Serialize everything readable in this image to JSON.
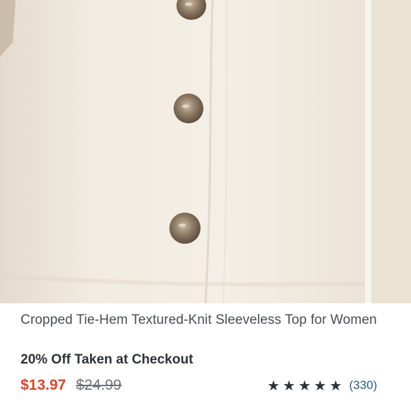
{
  "product": {
    "title": "Cropped Tie-Hem Textured-Knit Sleeveless Top for Women",
    "promo": "20% Off Taken at Checkout",
    "sale_price": "$13.97",
    "original_price": "$24.99",
    "rating": {
      "stars": "★★★★★",
      "review_count": "(330)",
      "star_color": "#2e3238"
    }
  },
  "colors": {
    "sale_price": "#d04a2f",
    "review_link": "#2a5a86"
  }
}
